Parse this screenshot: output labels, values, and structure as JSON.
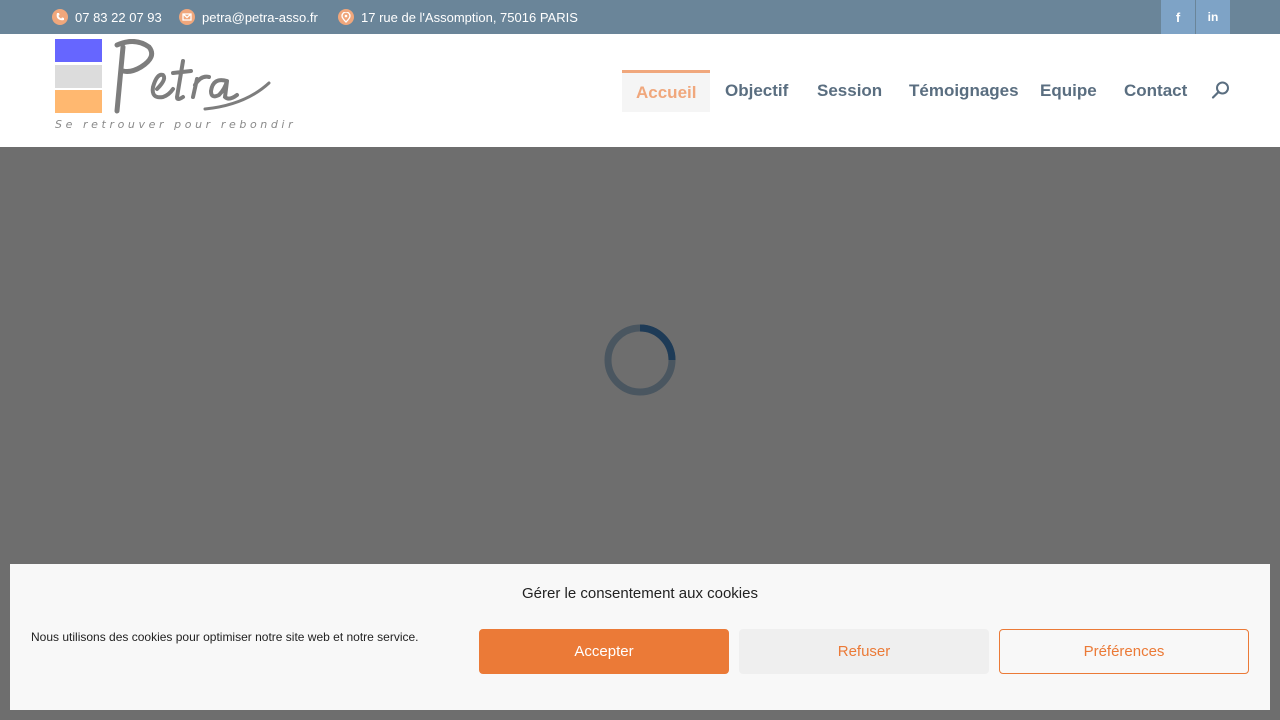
{
  "topbar": {
    "phone": "07 83 22 07 93",
    "email": "petra@petra-asso.fr",
    "address": "17 rue de l'Assomption, 75016 PARIS",
    "icons": {
      "phone": "phone-icon",
      "email": "mail-icon",
      "address": "location-pin-icon"
    },
    "social": [
      {
        "name": "facebook-icon",
        "glyph": "f"
      },
      {
        "name": "linkedin-icon",
        "glyph": "in"
      }
    ],
    "background": "#6a8599"
  },
  "logo": {
    "wordmark": "Petra",
    "tagline": "Se retrouver pour rebondir",
    "colors": [
      "#6666ff",
      "#dcdcdc",
      "#ffb870"
    ]
  },
  "nav": {
    "items": [
      {
        "label": "Accueil",
        "active": true
      },
      {
        "label": "Objectif",
        "active": false
      },
      {
        "label": "Session",
        "active": false
      },
      {
        "label": "Témoignages",
        "active": false
      },
      {
        "label": "Equipe",
        "active": false
      },
      {
        "label": "Contact",
        "active": false
      }
    ],
    "search_icon": "search-icon",
    "accent": "#f0a77c",
    "color": "#5a6e80"
  },
  "cookie": {
    "title": "Gérer le consentement aux cookies",
    "text": "Nous utilisons des cookies pour optimiser notre site web et notre service.",
    "accept": "Accepter",
    "refuse": "Refuser",
    "preferences": "Préférences",
    "accent": "#eb7a37"
  }
}
